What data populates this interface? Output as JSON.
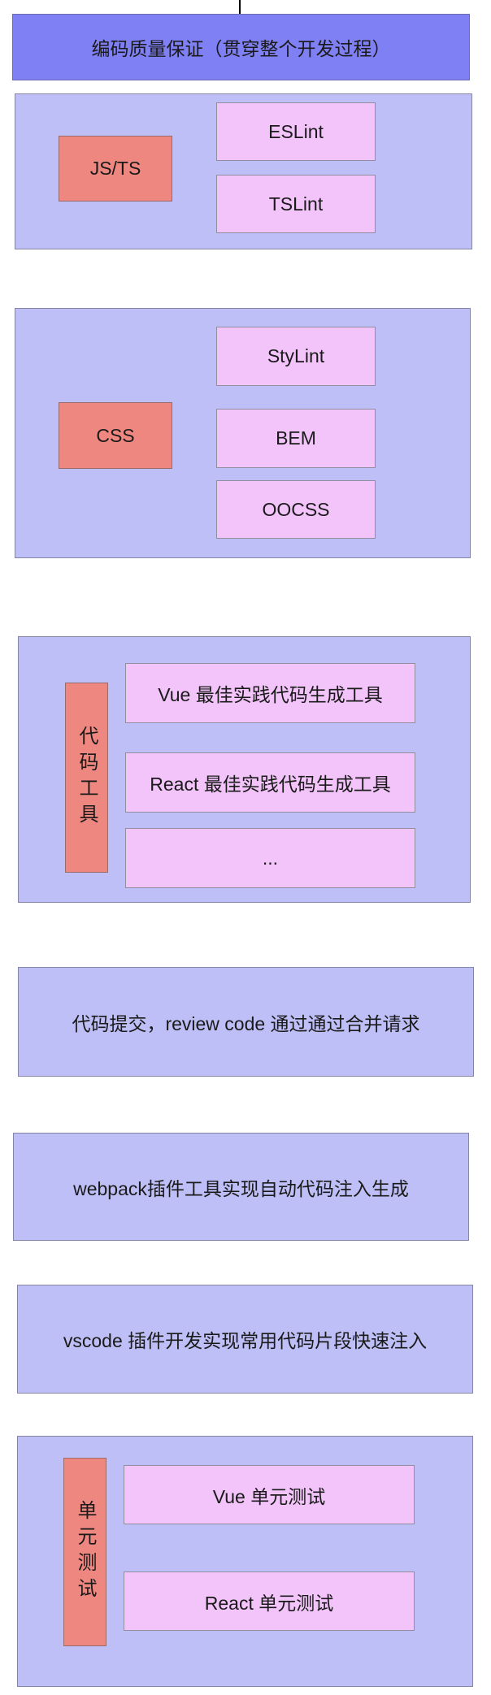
{
  "header": {
    "title": "编码质量保证（贯穿整个开发过程）"
  },
  "js_group": {
    "label": "JS/TS",
    "tools": [
      "ESLint",
      "TSLint"
    ]
  },
  "css_group": {
    "label": "CSS",
    "tools": [
      "StyLint",
      "BEM",
      "OOCSS"
    ]
  },
  "codetool_group": {
    "label": "代码工具",
    "tools": [
      "Vue 最佳实践代码生成工具",
      "React 最佳实践代码生成工具",
      "..."
    ]
  },
  "review": {
    "text": "代码提交，review code 通过通过合并请求"
  },
  "webpack": {
    "text": "webpack插件工具实现自动代码注入生成"
  },
  "vscode": {
    "text": "vscode 插件开发实现常用代码片段快速注入"
  },
  "unittest_group": {
    "label": "单元测试",
    "tools": [
      "Vue 单元测试",
      "React 单元测试"
    ]
  }
}
